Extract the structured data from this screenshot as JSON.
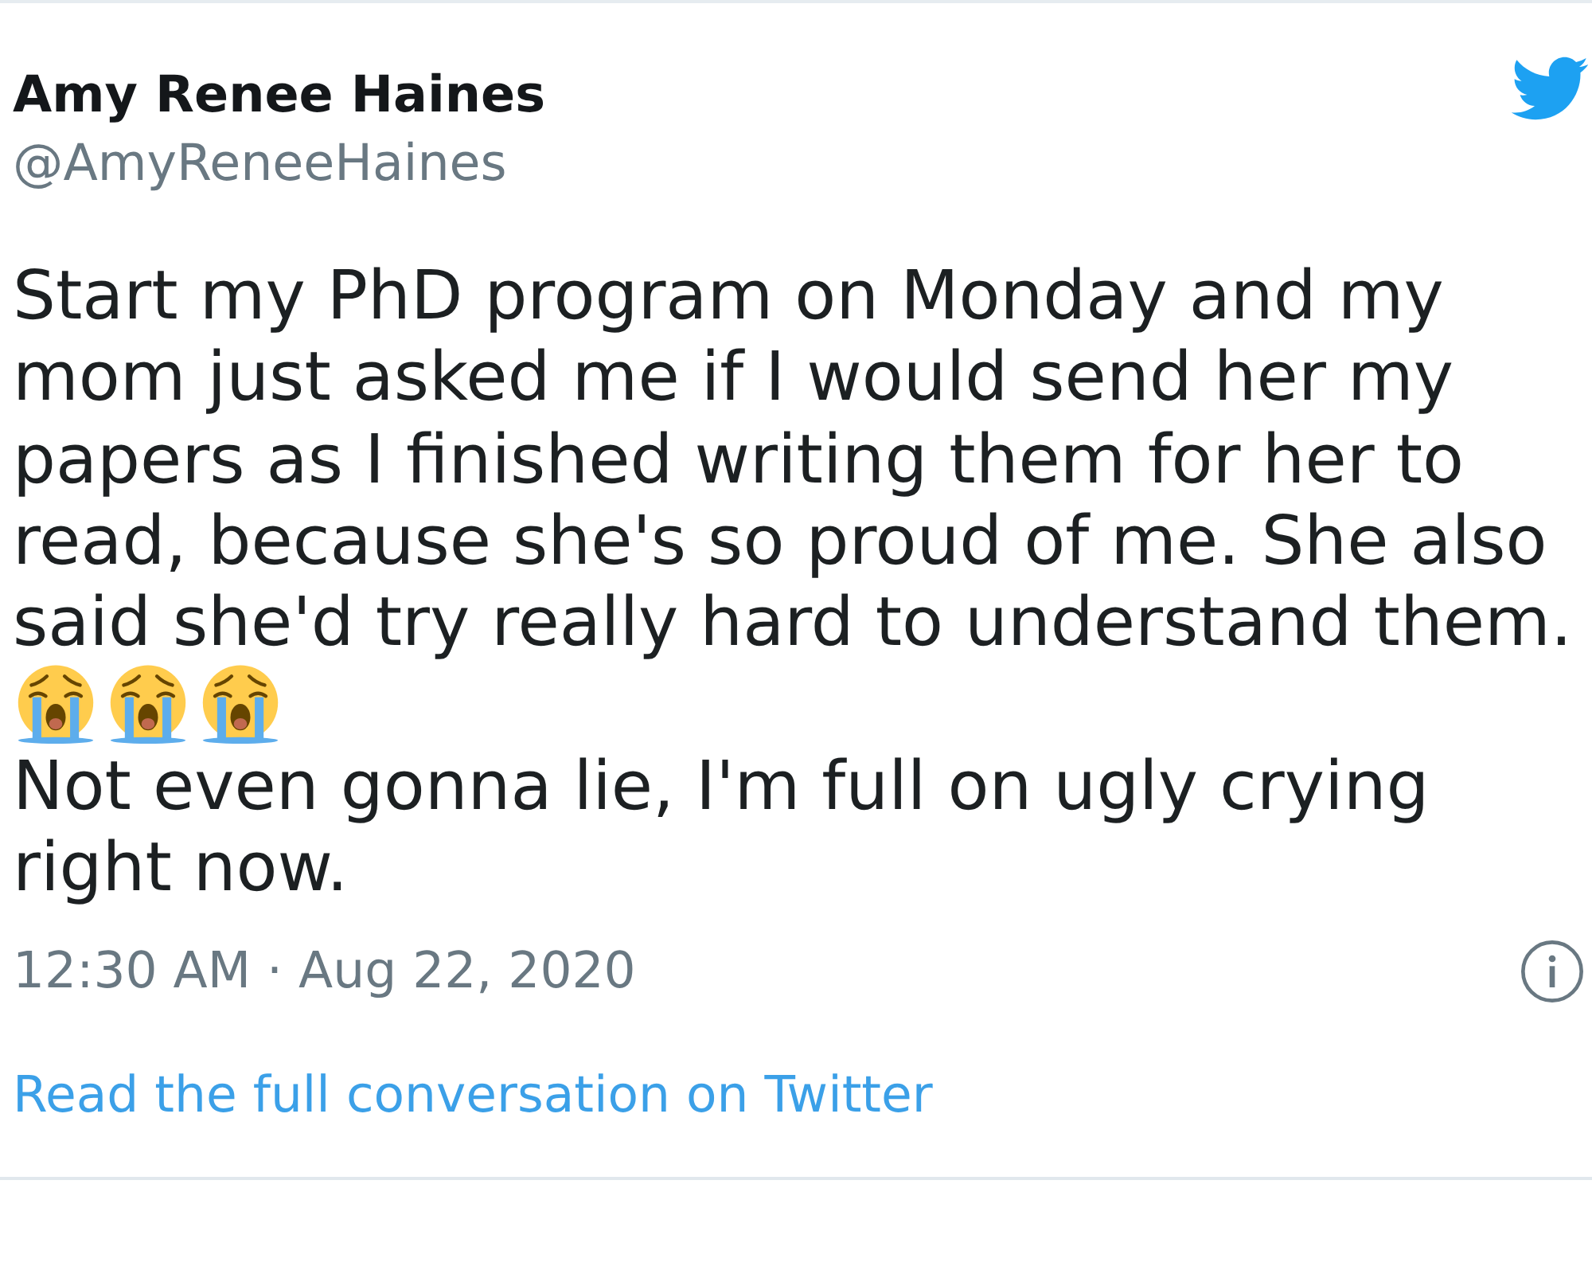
{
  "tweet": {
    "author_name": "Amy Renee Haines",
    "handle": "@AmyReneeHaines",
    "body": [
      {
        "kind": "text",
        "text": "Start my PhD program on Monday and my mom just asked me if I would send her my papers as I finished writing them for her to read, because she's so proud of me. She also said she'd try really hard to understand them."
      },
      {
        "kind": "emojis",
        "emojis": [
          {
            "kind": "loudly-crying"
          },
          {
            "kind": "loudly-crying"
          },
          {
            "kind": "loudly-crying"
          }
        ]
      },
      {
        "kind": "text",
        "text": "Not even gonna lie, I'm full on ugly crying right now."
      }
    ],
    "timestamp": "12:30 AM · Aug 22, 2020",
    "link": "Read the full conversation on Twitter"
  }
}
